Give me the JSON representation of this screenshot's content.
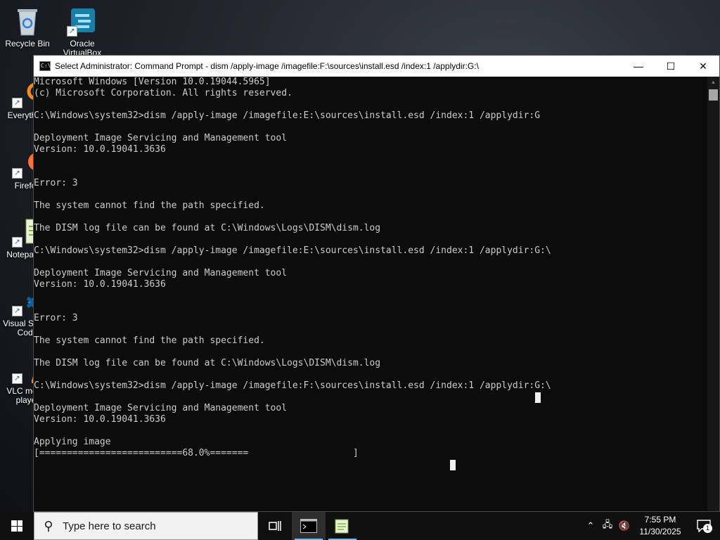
{
  "desktop": {
    "icons": [
      {
        "label": "Recycle Bin",
        "icon": "recycle-bin-icon"
      },
      {
        "label": "Oracle VirtualBox",
        "icon": "virtualbox-icon"
      },
      {
        "label": "Everything",
        "icon": "everything-icon"
      },
      {
        "label": "Firefox",
        "icon": "firefox-icon"
      },
      {
        "label": "Notepad++",
        "icon": "notepadpp-icon"
      },
      {
        "label": "Visual Studio Code",
        "icon": "vscode-icon"
      },
      {
        "label": "VLC media player",
        "icon": "vlc-icon"
      }
    ]
  },
  "window": {
    "title": "Select Administrator: Command Prompt - dism  /apply-image /imagefile:F:\\sources\\install.esd /index:1 /applydir:G:\\",
    "minimize": "—",
    "maximize": "☐",
    "close": "✕"
  },
  "console": {
    "lines": [
      "Microsoft Windows [Version 10.0.19044.5965]",
      "(c) Microsoft Corporation. All rights reserved.",
      "",
      "C:\\Windows\\system32>dism /apply-image /imagefile:E:\\sources\\install.esd /index:1 /applydir:G",
      "",
      "Deployment Image Servicing and Management tool",
      "Version: 10.0.19041.3636",
      "",
      "",
      "Error: 3",
      "",
      "The system cannot find the path specified.",
      "",
      "The DISM log file can be found at C:\\Windows\\Logs\\DISM\\dism.log",
      "",
      "C:\\Windows\\system32>dism /apply-image /imagefile:E:\\sources\\install.esd /index:1 /applydir:G:\\",
      "",
      "Deployment Image Servicing and Management tool",
      "Version: 10.0.19041.3636",
      "",
      "",
      "Error: 3",
      "",
      "The system cannot find the path specified.",
      "",
      "The DISM log file can be found at C:\\Windows\\Logs\\DISM\\dism.log",
      "",
      "C:\\Windows\\system32>dism /apply-image /imagefile:F:\\sources\\install.esd /index:1 /applydir:G:\\",
      "",
      "Deployment Image Servicing and Management tool",
      "Version: 10.0.19041.3636",
      "",
      "Applying image",
      "[==========================68.0%=======                   ]"
    ],
    "progress_percent": 68.0
  },
  "taskbar": {
    "search_placeholder": "Type here to search",
    "task_view_icon": "task-view-icon",
    "apps": [
      {
        "name": "Command Prompt",
        "icon": "cmd-icon",
        "active": true
      },
      {
        "name": "Notepad++",
        "icon": "notepadpp-icon",
        "active": false
      }
    ],
    "time": "7:55 PM",
    "date": "11/30/2025",
    "notification_count": "1"
  },
  "colors": {
    "console_bg": "#0c0c0c",
    "console_fg": "#cccccc",
    "taskbar_bg": "#101010",
    "accent": "#76b9ed"
  }
}
